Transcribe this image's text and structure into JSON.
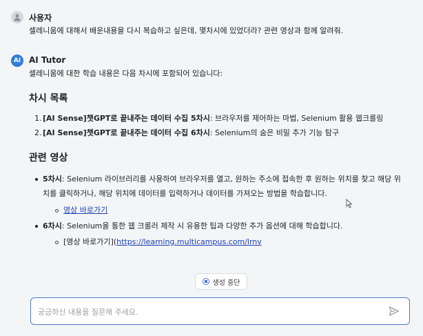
{
  "messages": {
    "user": {
      "sender": "사용자",
      "text": "셀레니움에 대해서 배운내용을 다시 복습하고 싶은데, 몇차시에 있었더라? 관련 영상과 함께 알려줘."
    },
    "ai": {
      "sender": "AI Tutor",
      "intro": "셀레니움에 대한 학습 내용은 다음 차시에 포함되어 있습니다:",
      "section1_title": "차시 목록",
      "list": [
        {
          "num": "1.",
          "bold": "[AI Sense]챗GPT로 끝내주는 데이터 수집 5차시",
          "rest": ": 브라우저를 제어하는 마법, Selenium 활용 웹크롤링"
        },
        {
          "num": "2.",
          "bold": "[AI Sense]챗GPT로 끝내주는 데이터 수집 6차시",
          "rest": ": Selenium의 숨은 비밀 추가 기능 탐구"
        }
      ],
      "section2_title": "관련 영상",
      "videos": [
        {
          "bold": "5차시",
          "line1": ": Selenium 라이브러리를 사용하여 브라우저를 열고, 원하는 주소에 접속한 후 원하는 위치를 찾고 해당 위",
          "line2": "치를 클릭하거나, 해당 위치에 데이터를 입력하거나 데이터를 가져오는 방법을 학습합니다.",
          "sub": "영상 바로가기"
        },
        {
          "bold": "6차시",
          "line1": ": Selenium을 통한 웹 크롤러 제작 시 유용한 팁과 다양한 추가 옵션에 대해 학습합니다.",
          "sub_prefix": "[영상 바로가기](",
          "sub_url": "https://learning.multicampus.com/lrnv"
        }
      ]
    }
  },
  "stop_button": {
    "label": "생성 중단",
    "icon": "stop-icon"
  },
  "input": {
    "placeholder": "궁금하신 내용을 질문해 주세요."
  },
  "colors": {
    "accent": "#4a7bd0",
    "link": "#1a3fb5",
    "ai_avatar": "#2f7dd8"
  }
}
